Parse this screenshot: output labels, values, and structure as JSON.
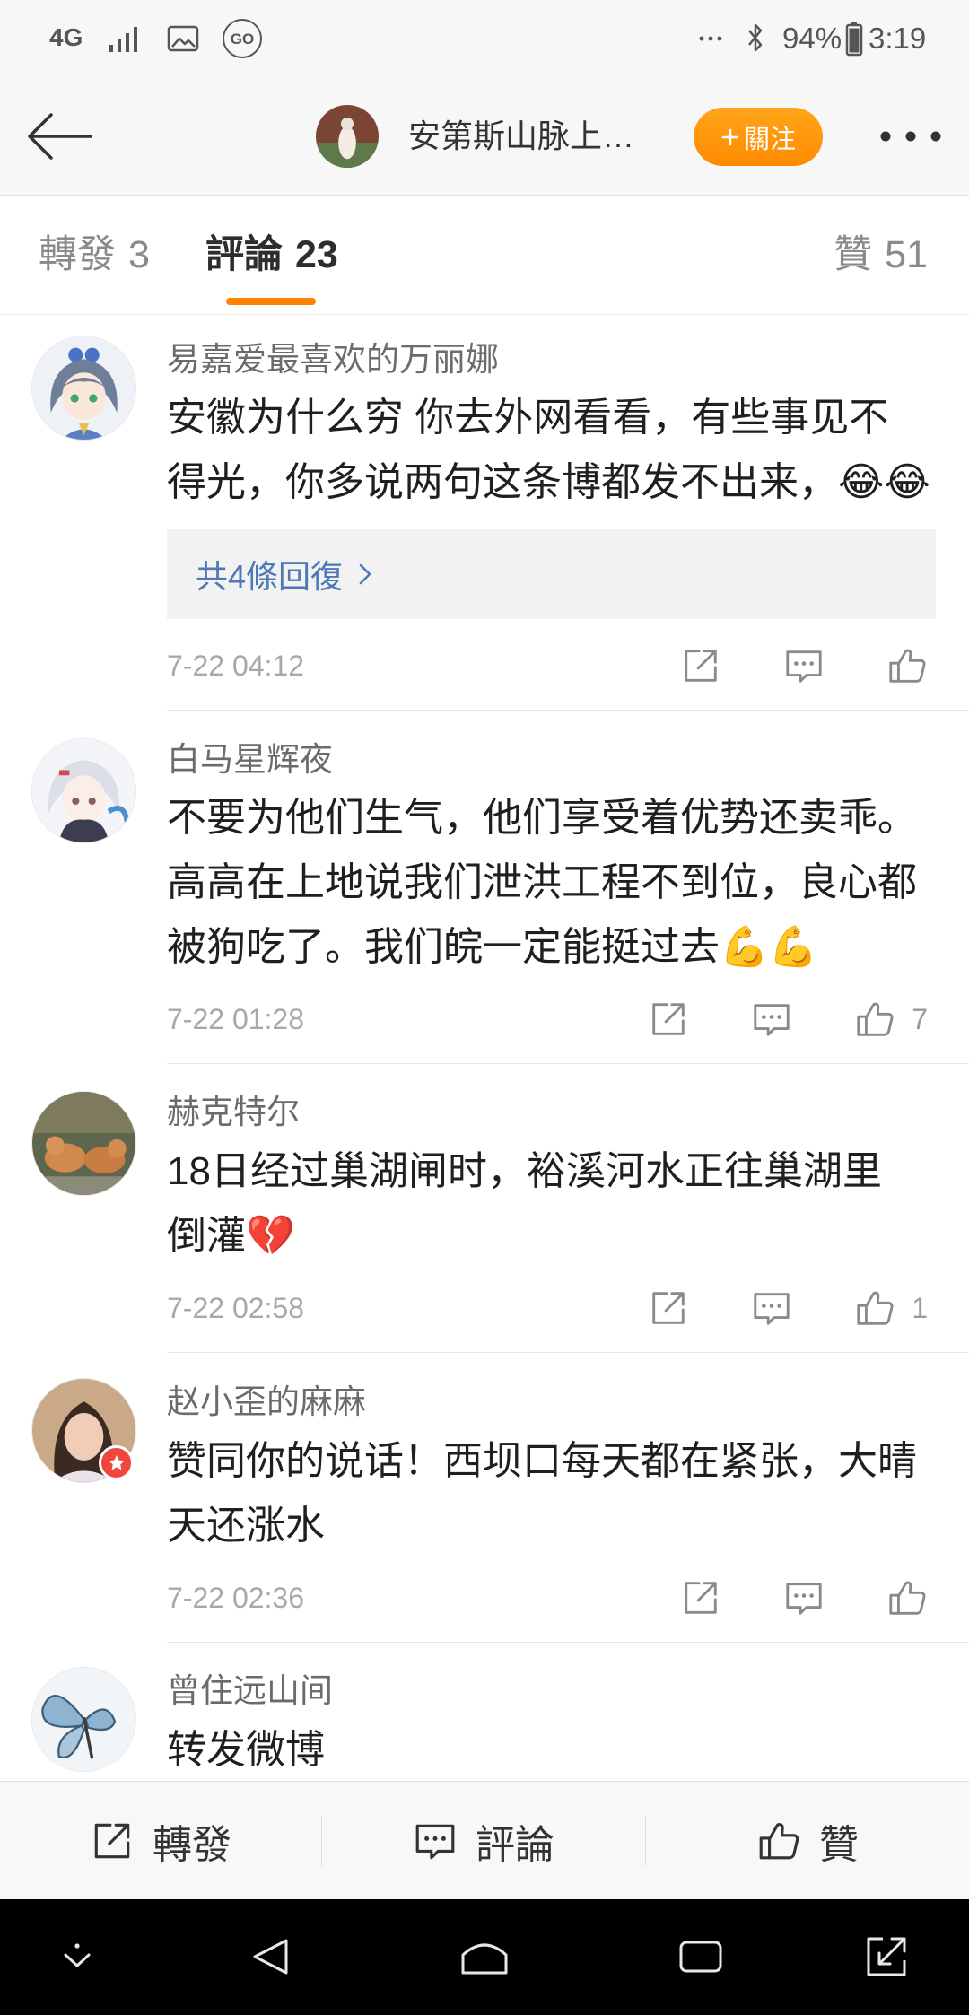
{
  "status_bar": {
    "network_type": "4G",
    "go_badge": "GO",
    "battery_percent": "94%",
    "time": "3:19"
  },
  "header": {
    "title": "安第斯山脉上…",
    "follow_label": "關注"
  },
  "tabs": [
    {
      "label": "轉發",
      "count": "3"
    },
    {
      "label": "評論",
      "count": "23",
      "active": true
    },
    {
      "label": "贊",
      "count": "51"
    }
  ],
  "comments": [
    {
      "user": "易嘉爱最喜欢的万丽娜",
      "text": "安徽为什么穷 你去外网看看，有些事见不\n得光，你多说两句这条博都发不出来，😂😂",
      "replies_label": "共4條回復",
      "time": "7-22 04:12"
    },
    {
      "user": "白马星辉夜",
      "text": "不要为他们生气，他们享受着优势还卖乖。\n高高在上地说我们泄洪工程不到位，良心都\n被狗吃了。我们皖一定能挺过去💪💪",
      "time": "7-22 01:28",
      "likes": "7"
    },
    {
      "user": "赫克特尔",
      "text": "18日经过巢湖闸时，裕溪河水正往巢湖里\n倒灌💔",
      "time": "7-22 02:58",
      "likes": "1"
    },
    {
      "user": "赵小歪的麻麻",
      "text": "赞同你的说话！西坝口每天都在紧张，大晴\n天还涨水",
      "time": "7-22 02:36"
    },
    {
      "user": "曾住远山间",
      "text": "转发微博"
    }
  ],
  "bottom_bar": {
    "repost_label": "轉發",
    "comment_label": "評論",
    "like_label": "贊"
  },
  "icons": {
    "header": [
      "back-arrow-icon",
      "plus-icon",
      "more-options-icon"
    ],
    "comment_actions": [
      "share-icon",
      "comment-icon",
      "like-icon"
    ],
    "nav": [
      "nav-collapse-icon",
      "nav-back-icon",
      "nav-home-icon",
      "nav-recents-icon",
      "nav-expand-icon"
    ]
  },
  "colors": {
    "accent": "#ff8200",
    "link": "#4f79b4",
    "text": "#1f1f1f",
    "muted": "#a8a8a8"
  }
}
